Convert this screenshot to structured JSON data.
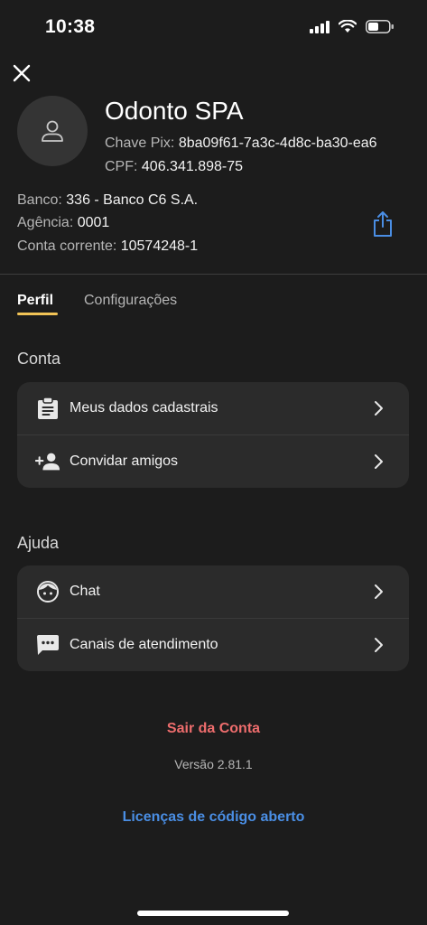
{
  "status_bar": {
    "time": "10:38",
    "icons": [
      "signal-icon",
      "wifi-icon",
      "battery-icon"
    ]
  },
  "header": {
    "close_icon": "close-icon",
    "avatar_icon": "person-icon",
    "name": "Odonto SPA",
    "pix_label": "Chave Pix:",
    "pix_value": "8ba09f61-7a3c-4d8c-ba30-ea6",
    "cpf_label": "CPF:",
    "cpf_value": "406.341.898-75",
    "bank_label": "Banco:",
    "bank_value": "336 - Banco C6 S.A.",
    "agency_label": "Agência:",
    "agency_value": "0001",
    "account_label": "Conta corrente:",
    "account_value": "10574248-1",
    "share_icon": "share-icon"
  },
  "tabs": [
    {
      "label": "Perfil",
      "active": true
    },
    {
      "label": "Configurações",
      "active": false
    }
  ],
  "sections": {
    "account": {
      "title": "Conta",
      "items": [
        {
          "label": "Meus dados cadastrais",
          "icon": "clipboard-icon"
        },
        {
          "label": "Convidar amigos",
          "icon": "add-person-icon"
        }
      ]
    },
    "help": {
      "title": "Ajuda",
      "items": [
        {
          "label": "Chat",
          "icon": "chat-face-icon"
        },
        {
          "label": "Canais de atendimento",
          "icon": "message-dots-icon"
        }
      ]
    }
  },
  "footer": {
    "logout": "Sair da Conta",
    "version": "Versão 2.81.1",
    "licenses": "Licenças de código aberto"
  },
  "colors": {
    "background": "#1c1c1c",
    "card": "#2b2b2b",
    "accent_tab": "#f1c356",
    "logout": "#ee6d6d",
    "link": "#4a8ee4"
  }
}
